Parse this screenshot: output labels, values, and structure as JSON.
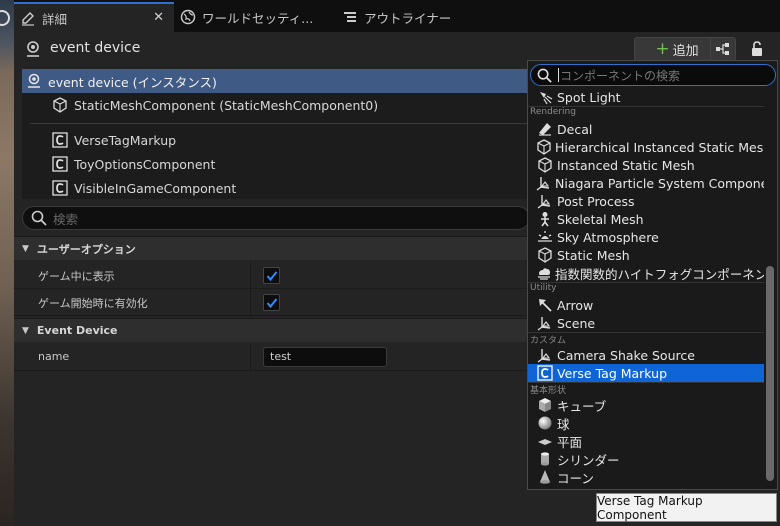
{
  "tabs": [
    {
      "label": "詳細",
      "icon": "pencil-icon",
      "active": true
    },
    {
      "label": "ワールドセッティ...",
      "icon": "globe-icon",
      "active": false
    },
    {
      "label": "アウトライナー",
      "icon": "list-icon",
      "active": false
    }
  ],
  "tab_close": "✕",
  "header": {
    "actor_name": "event device",
    "add_label": "追加"
  },
  "tree": {
    "instance": "event device (インスタンス)",
    "mesh": "StaticMeshComponent (StaticMeshComponent0)",
    "components": [
      "VerseTagMarkup",
      "ToyOptionsComponent",
      "VisibleInGameComponent"
    ]
  },
  "details_search_placeholder": "検索",
  "categories": {
    "user_options": "ユーザーオプション",
    "event_device": "Event Device"
  },
  "properties": {
    "show_in_game": {
      "label": "ゲーム中に表示",
      "checked": true
    },
    "enable_on_start": {
      "label": "ゲーム開始時に有効化",
      "checked": true
    },
    "name": {
      "label": "name",
      "value": "test"
    }
  },
  "popup": {
    "search_placeholder": "コンポーネントの検索",
    "items": [
      {
        "kind": "item",
        "label": "Spot Light",
        "icon": "spot-light-icon"
      },
      {
        "kind": "header",
        "label": "Rendering"
      },
      {
        "kind": "item",
        "label": "Decal",
        "icon": "decal-icon"
      },
      {
        "kind": "item",
        "label": "Hierarchical Instanced Static Mesh",
        "icon": "mesh-icon"
      },
      {
        "kind": "item",
        "label": "Instanced Static Mesh",
        "icon": "mesh-icon"
      },
      {
        "kind": "item",
        "label": "Niagara Particle System Component",
        "icon": "scene-icon"
      },
      {
        "kind": "item",
        "label": "Post Process",
        "icon": "scene-icon"
      },
      {
        "kind": "item",
        "label": "Skeletal Mesh",
        "icon": "skeleton-icon"
      },
      {
        "kind": "item",
        "label": "Sky Atmosphere",
        "icon": "sun-icon"
      },
      {
        "kind": "item",
        "label": "Static Mesh",
        "icon": "mesh-icon"
      },
      {
        "kind": "item",
        "label": "指数関数的ハイトフォグコンポーネン",
        "icon": "fog-icon"
      },
      {
        "kind": "header",
        "label": "Utility"
      },
      {
        "kind": "item",
        "label": "Arrow",
        "icon": "arrow-icon"
      },
      {
        "kind": "item",
        "label": "Scene",
        "icon": "scene-icon"
      },
      {
        "kind": "header",
        "label": "カスタム"
      },
      {
        "kind": "item",
        "label": "Camera Shake Source",
        "icon": "scene-icon"
      },
      {
        "kind": "item",
        "label": "Verse Tag Markup",
        "icon": "component-c-icon",
        "selected": true
      },
      {
        "kind": "header",
        "label": "基本形状"
      },
      {
        "kind": "item",
        "label": "キューブ",
        "icon": "cube-icon"
      },
      {
        "kind": "item",
        "label": "球",
        "icon": "sphere-icon"
      },
      {
        "kind": "item",
        "label": "平面",
        "icon": "plane-icon"
      },
      {
        "kind": "item",
        "label": "シリンダー",
        "icon": "cylinder-icon"
      },
      {
        "kind": "item",
        "label": "コーン",
        "icon": "cone-icon"
      }
    ]
  },
  "tooltip": "Verse Tag Markup Component",
  "colors": {
    "selection": "#0f64d6",
    "tree_selection": "#3f5b85",
    "add_plus": "#6fc34d",
    "focus": "#2f6fd0"
  }
}
